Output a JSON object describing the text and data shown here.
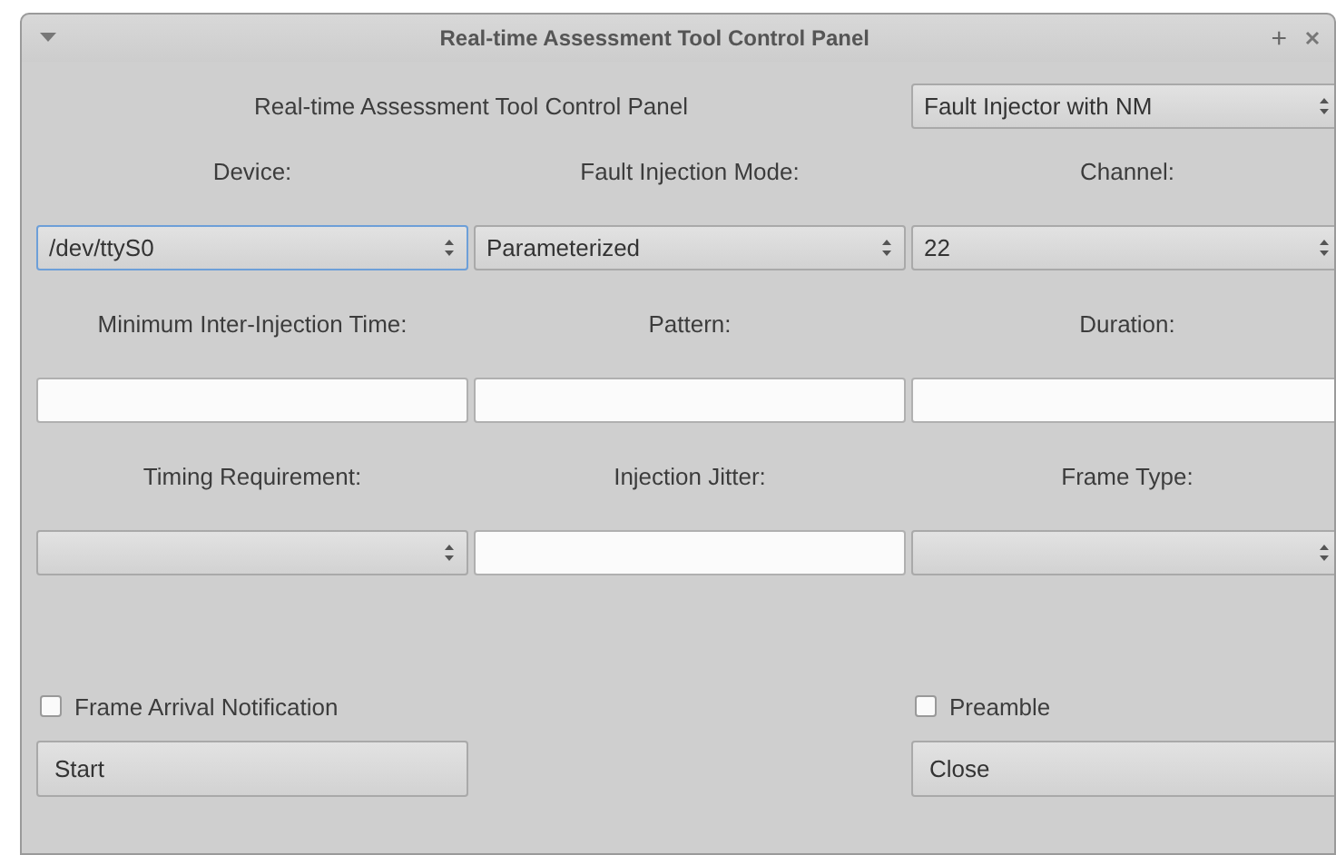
{
  "window": {
    "title": "Real-time Assessment Tool Control Panel",
    "buttons": [
      "+"
    ]
  },
  "header": {
    "label": "Real-time Assessment Tool Control Panel",
    "mode_select": {
      "value": "Fault Injector with NM"
    }
  },
  "fields": [
    {
      "label": "Device:",
      "kind": "combo",
      "value": "/dev/ttyS0",
      "focused": true
    },
    {
      "label": "Fault Injection Mode:",
      "kind": "combo",
      "value": "Parameterized",
      "focused": false
    },
    {
      "label": "Channel:",
      "kind": "combo",
      "value": "22",
      "focused": false
    },
    {
      "label": "Minimum Inter-Injection Time:",
      "kind": "text",
      "focused": false
    },
    {
      "label": "Pattern:",
      "kind": "text",
      "focused": false
    },
    {
      "label": "Duration:",
      "kind": "text",
      "focused": false
    },
    {
      "label": "Timing Requirement:",
      "kind": "combo",
      "focused": false
    },
    {
      "label": "Injection Jitter:",
      "kind": "text",
      "focused": false
    },
    {
      "label": "Frame Type:",
      "kind": "combo",
      "focused": false
    }
  ],
  "options": [
    {
      "label": "Frame Arrival Notification",
      "checked": false
    },
    {
      "label": "Preamble",
      "checked": false
    }
  ],
  "buttons": [
    "Start",
    "Close"
  ]
}
